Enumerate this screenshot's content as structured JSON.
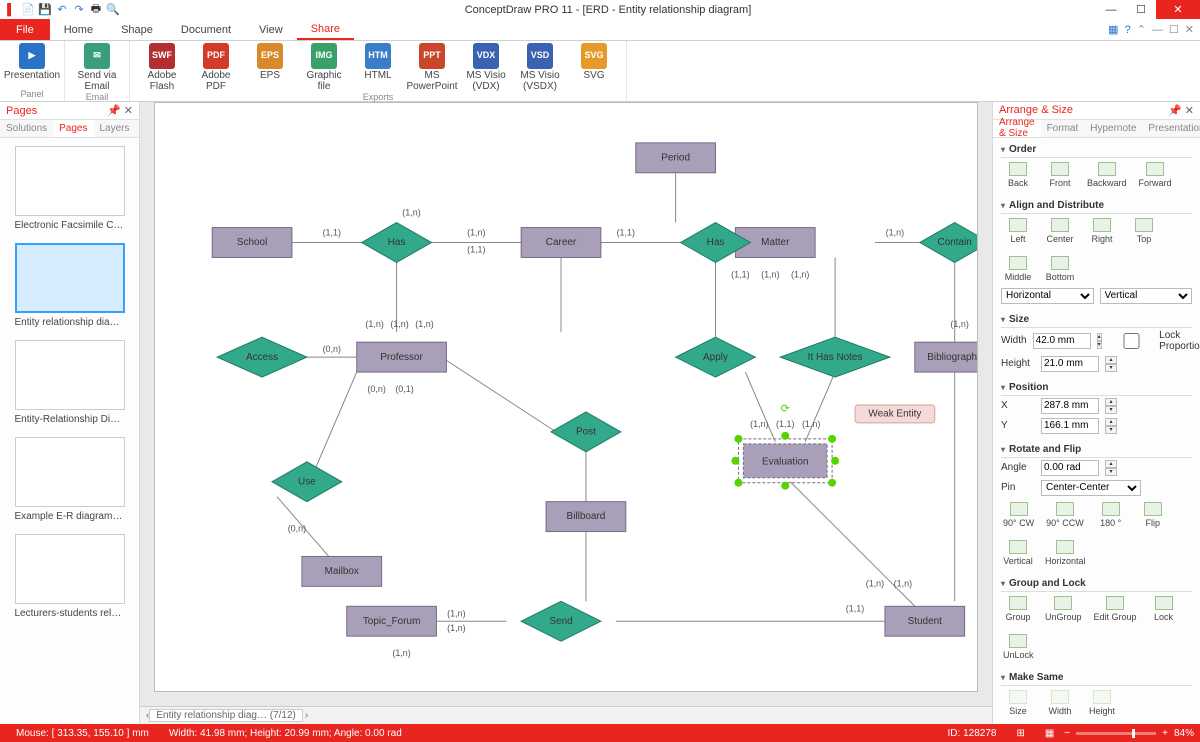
{
  "app_title": "ConceptDraw PRO 11 - [ERD - Entity relationship diagram]",
  "ribbon_tabs": {
    "file": "File",
    "home": "Home",
    "shape": "Shape",
    "document": "Document",
    "view": "View",
    "share": "Share"
  },
  "ribbon": {
    "presentation": "Presentation",
    "panel": "Panel",
    "sendemail": "Send via Email",
    "email": "Email",
    "flash": "Adobe Flash",
    "pdf": "Adobe PDF",
    "eps": "EPS",
    "graphic": "Graphic file",
    "html": "HTML",
    "ppt": "MS PowerPoint",
    "vdx": "MS Visio (VDX)",
    "vsdx": "MS Visio (VSDX)",
    "svg": "SVG",
    "exports": "Exports"
  },
  "left_panel": {
    "title": "Pages",
    "tabs": {
      "solutions": "Solutions",
      "pages": "Pages",
      "layers": "Layers"
    },
    "thumbs": [
      "Electronic Facsimile Coll…",
      "Entity relationship diagram",
      "Entity-Relationship Diagr…",
      "Example E-R diagram ext…",
      "Lecturers-students relatio…"
    ]
  },
  "right_panel": {
    "title": "Arrange & Size",
    "tabs": {
      "arrange": "Arrange & Size",
      "format": "Format",
      "hypernote": "Hypernote",
      "presentation": "Presentation"
    },
    "order": {
      "hd": "Order",
      "back": "Back",
      "front": "Front",
      "backward": "Backward",
      "forward": "Forward"
    },
    "align": {
      "hd": "Align and Distribute",
      "left": "Left",
      "center": "Center",
      "right": "Right",
      "top": "Top",
      "middle": "Middle",
      "bottom": "Bottom",
      "horiz": "Horizontal",
      "vert": "Vertical"
    },
    "size": {
      "hd": "Size",
      "width_l": "Width",
      "width_v": "42.0 mm",
      "height_l": "Height",
      "height_v": "21.0 mm",
      "lock": "Lock Proportions"
    },
    "position": {
      "hd": "Position",
      "x_l": "X",
      "x_v": "287.8 mm",
      "y_l": "Y",
      "y_v": "166.1 mm"
    },
    "rotate": {
      "hd": "Rotate and Flip",
      "angle_l": "Angle",
      "angle_v": "0.00 rad",
      "pin_l": "Pin",
      "pin_v": "Center-Center",
      "cw": "90° CW",
      "ccw": "90° CCW",
      "d180": "180 °",
      "flip": "Flip",
      "vert": "Vertical",
      "horiz": "Horizontal"
    },
    "group": {
      "hd": "Group and Lock",
      "group": "Group",
      "ungroup": "UnGroup",
      "edit": "Edit Group",
      "lock": "Lock",
      "unlock": "UnLock"
    },
    "make": {
      "hd": "Make Same",
      "size": "Size",
      "width": "Width",
      "height": "Height"
    }
  },
  "diagram": {
    "entities": {
      "school": "School",
      "career": "Career",
      "period": "Period",
      "matter": "Matter",
      "bibliography": "Bibliography",
      "professor": "Professor",
      "billboard": "Billboard",
      "mailbox": "Mailbox",
      "topic": "Topic_Forum",
      "student": "Student",
      "evaluation": "Evaluation"
    },
    "rels": {
      "has1": "Has",
      "has2": "Has",
      "contain": "Contain",
      "access": "Access",
      "apply": "Apply",
      "ithasnotes": "It Has Notes",
      "use": "Use",
      "post": "Post",
      "send": "Send"
    },
    "tooltip": "Weak Entity",
    "card": {
      "c11": "(1,1)",
      "c1n": "(1,n)",
      "c0n": "(0,n)",
      "c01": "(0,1)"
    }
  },
  "doc_tabs": {
    "name": "Entity relationship diag…",
    "count": "(7/12)"
  },
  "status": {
    "mouse": "Mouse: [ 313.35, 155.10 ] mm",
    "dims": "Width: 41.98 mm;  Height: 20.99 mm;  Angle: 0.00 rad",
    "id": "ID: 128278",
    "zoom": "84%"
  }
}
